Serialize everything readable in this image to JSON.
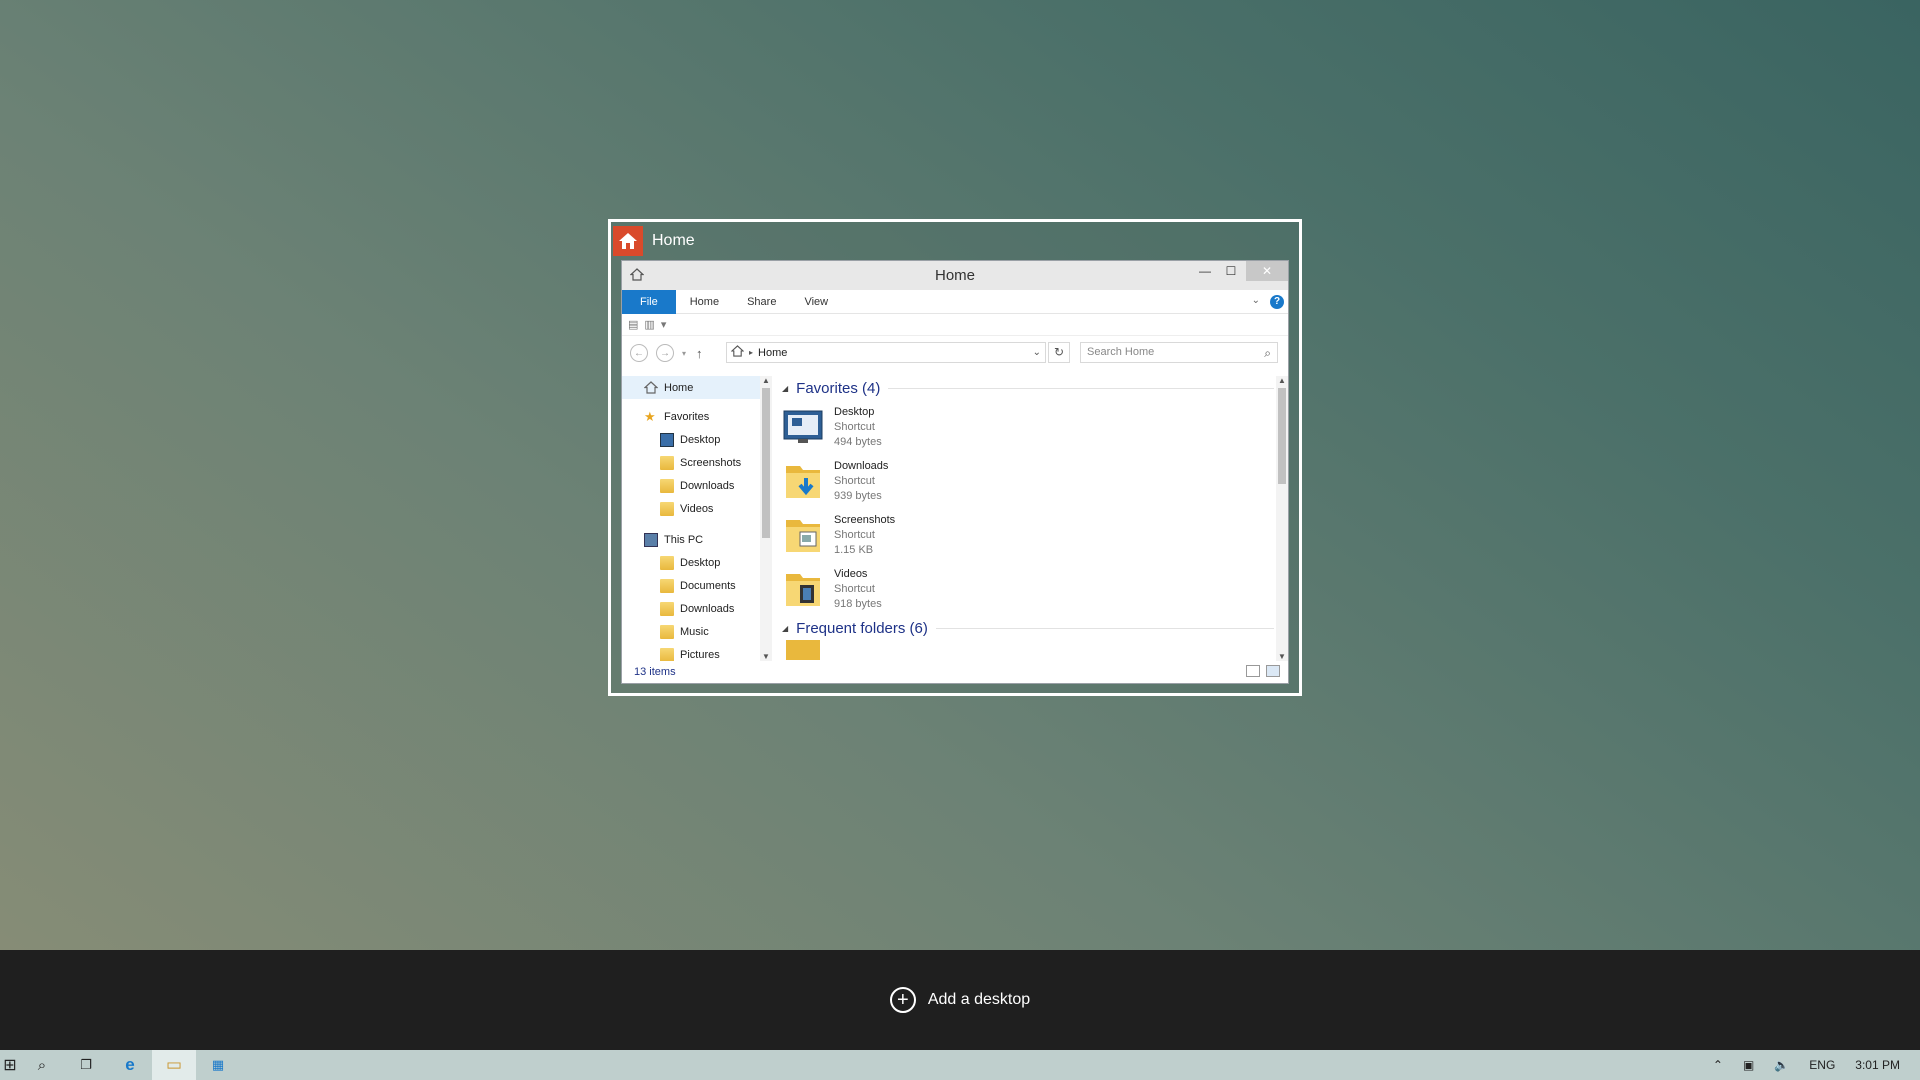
{
  "thumbnail": {
    "title": "Home"
  },
  "window": {
    "title": "Home",
    "controls": {
      "minimize": "—",
      "maximize": "☐",
      "close": "✕"
    },
    "ribbon_tabs": [
      "File",
      "Home",
      "Share",
      "View"
    ],
    "address": {
      "path": "Home"
    },
    "search": {
      "placeholder": "Search Home"
    },
    "nav": {
      "home": "Home",
      "favorites": "Favorites",
      "favorites_items": [
        "Desktop",
        "Screenshots",
        "Downloads",
        "Videos"
      ],
      "this_pc": "This PC",
      "pc_items": [
        "Desktop",
        "Documents",
        "Downloads",
        "Music",
        "Pictures"
      ]
    },
    "groups": [
      {
        "title": "Favorites (4)",
        "items": [
          {
            "name": "Desktop",
            "type": "Shortcut",
            "size": "494 bytes"
          },
          {
            "name": "Downloads",
            "type": "Shortcut",
            "size": "939 bytes"
          },
          {
            "name": "Screenshots",
            "type": "Shortcut",
            "size": "1.15 KB"
          },
          {
            "name": "Videos",
            "type": "Shortcut",
            "size": "918 bytes"
          }
        ]
      },
      {
        "title": "Frequent folders (6)"
      }
    ],
    "status": "13 items"
  },
  "task_view": {
    "add_desktop": "Add a desktop",
    "plus_symbol": "+"
  },
  "taskbar": {
    "start_glyph": "⊞",
    "search_glyph": "⌕",
    "task_glyph": "❐",
    "ie_glyph": "e",
    "explorer_glyph": "▭",
    "store_glyph": "▦"
  },
  "tray": {
    "chevron": "⌃",
    "network": "▣",
    "volume": "🔈",
    "lang": "ENG",
    "time": "3:01 PM"
  }
}
